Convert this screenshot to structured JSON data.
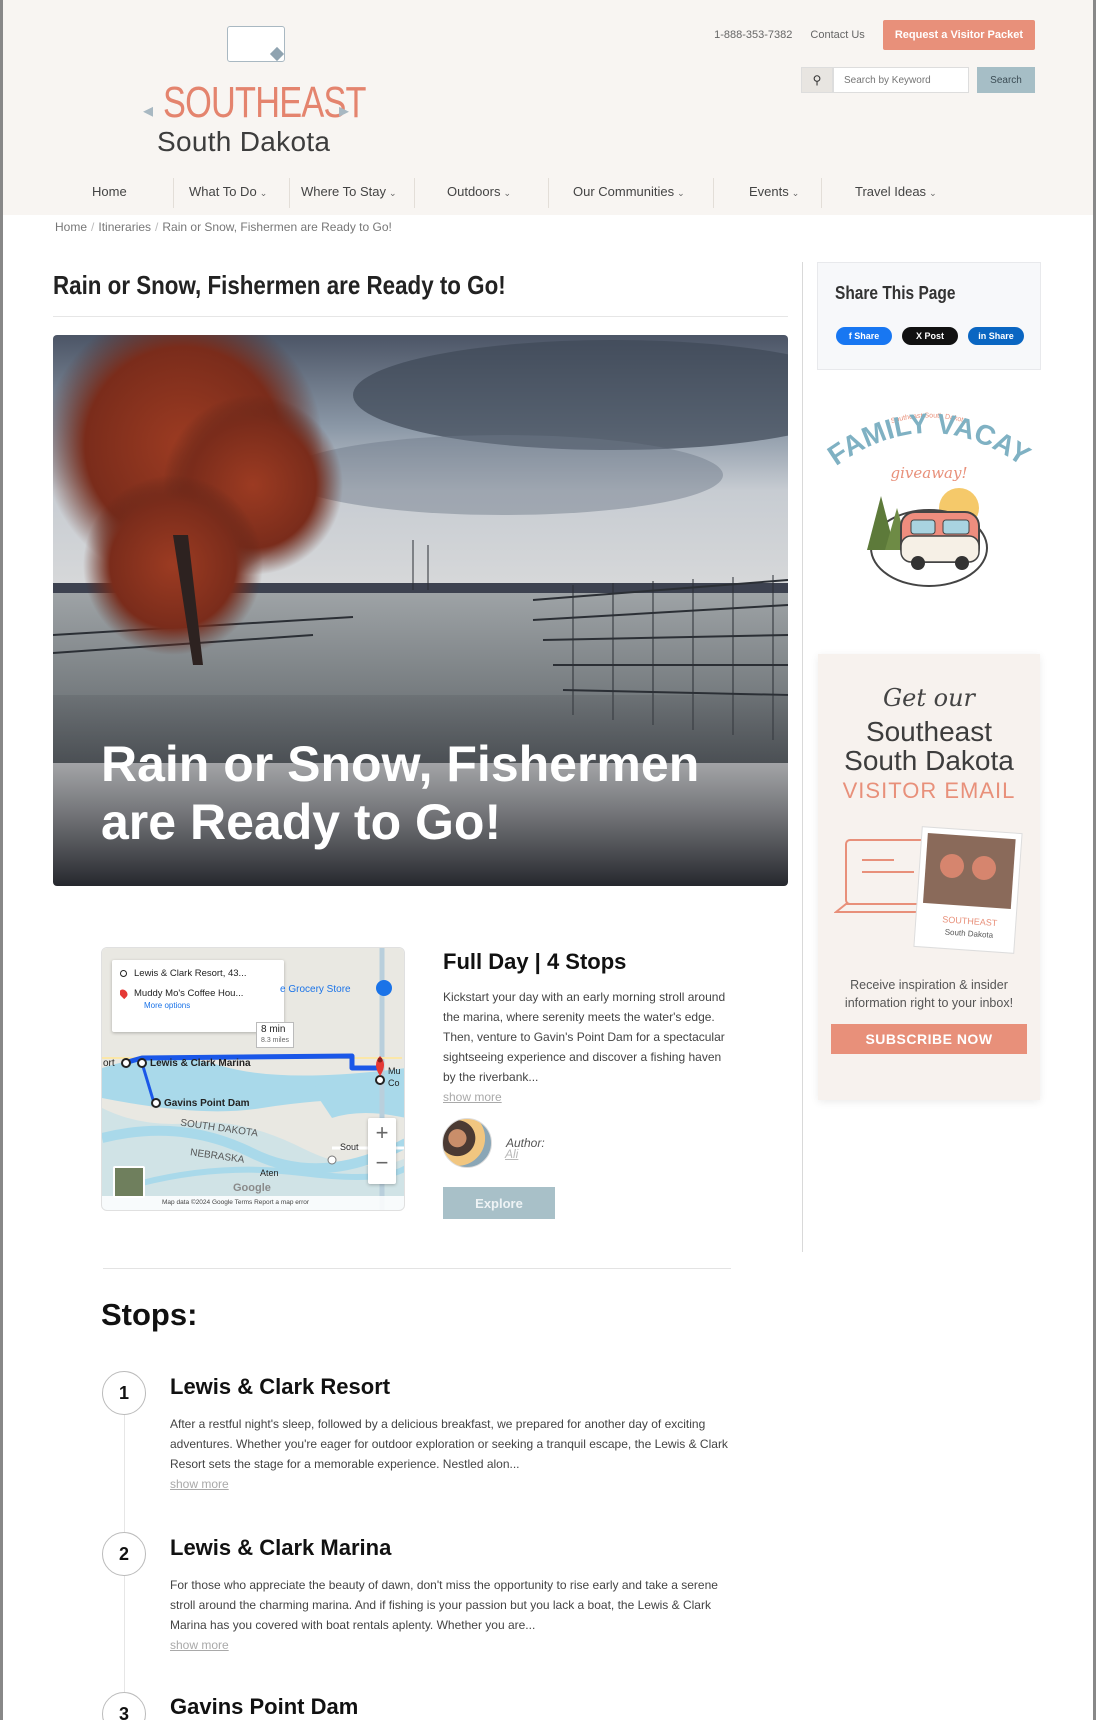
{
  "header": {
    "logo_main": "SOUTHEAST",
    "logo_sub": "South Dakota",
    "phone": "1-888-353-7382",
    "contact": "Contact Us",
    "visitor_button": "Request a Visitor Packet",
    "search_placeholder": "Search by Keyword",
    "search_button": "Search"
  },
  "nav": [
    "Home",
    "What To Do",
    "Where To Stay",
    "Outdoors",
    "Our Communities",
    "Events",
    "Travel Ideas"
  ],
  "breadcrumb": [
    "Home",
    "Itineraries",
    "Rain or Snow, Fishermen are Ready to Go!"
  ],
  "page": {
    "title": "Rain or Snow, Fishermen are Ready to Go!",
    "hero_text": "Rain or Snow, Fishermen are Ready to Go!"
  },
  "map": {
    "origin": "Lewis & Clark Resort, 43...",
    "destination": "Muddy Mo's Coffee Hou...",
    "more_options": "More options",
    "duration": "8 min",
    "distance": "8.3 miles",
    "labels": {
      "grocery": "e Grocery Store",
      "marina": "Lewis & Clark Marina",
      "dam": "Gavins Point Dam",
      "south_dakota": "SOUTH DAKOTA",
      "nebraska": "NEBRASKA",
      "aten": "Aten",
      "port": "ort",
      "mu": "Mu",
      "co": "Co",
      "sout": "Sout",
      "google": "Google"
    },
    "footer": "Map data ©2024 Google    Terms    Report a map error"
  },
  "summary": {
    "title": "Full Day | 4 Stops",
    "description": "Kickstart your day with an early morning stroll around the marina, where serenity meets the water's edge. Then, venture to Gavin's Point Dam for a spectacular sightseeing experience and discover a fishing haven by the riverbank...",
    "show_more": "show more",
    "author_label": "Author:",
    "author_name": "Ali",
    "explore_button": "Explore"
  },
  "stops": {
    "heading": "Stops:",
    "items": [
      {
        "number": "1",
        "title": "Lewis & Clark Resort",
        "description": "After a restful night's sleep, followed by a delicious breakfast, we prepared for another day of exciting adventures. Whether you're eager for outdoor exploration or seeking a tranquil escape, the Lewis & Clark Resort sets the stage for a memorable experience. Nestled alon...",
        "show_more": "show more"
      },
      {
        "number": "2",
        "title": "Lewis & Clark Marina",
        "description": "For those who appreciate the beauty of dawn, don't miss the opportunity to rise early and take a serene stroll around the charming marina. And if fishing is your passion but you lack a boat, the Lewis & Clark Marina has you covered with boat rentals aplenty. Whether you are...",
        "show_more": "show more"
      },
      {
        "number": "3",
        "title": "Gavins Point Dam"
      }
    ]
  },
  "sidebar": {
    "share_title": "Share This Page",
    "share_facebook": "f Share",
    "share_x": "X Post",
    "share_linkedin": "in Share",
    "promo_small": "Southeast South Dakota",
    "promo_title": "FAMILY VACAY",
    "promo_script": "giveaway!",
    "email_script": "Get our",
    "email_line1": "Southeast",
    "email_line2": "South Dakota",
    "email_line3": "VISITOR EMAIL",
    "email_art_text": "SOUTHEAST",
    "email_art_sub": "South Dakota",
    "email_caption": "Receive inspiration & insider information right to your inbox!",
    "subscribe_button": "SUBSCRIBE NOW"
  },
  "colors": {
    "accent": "#e8907a",
    "muted_button": "#a8c0c8",
    "header_bg": "#f8f5f2"
  }
}
